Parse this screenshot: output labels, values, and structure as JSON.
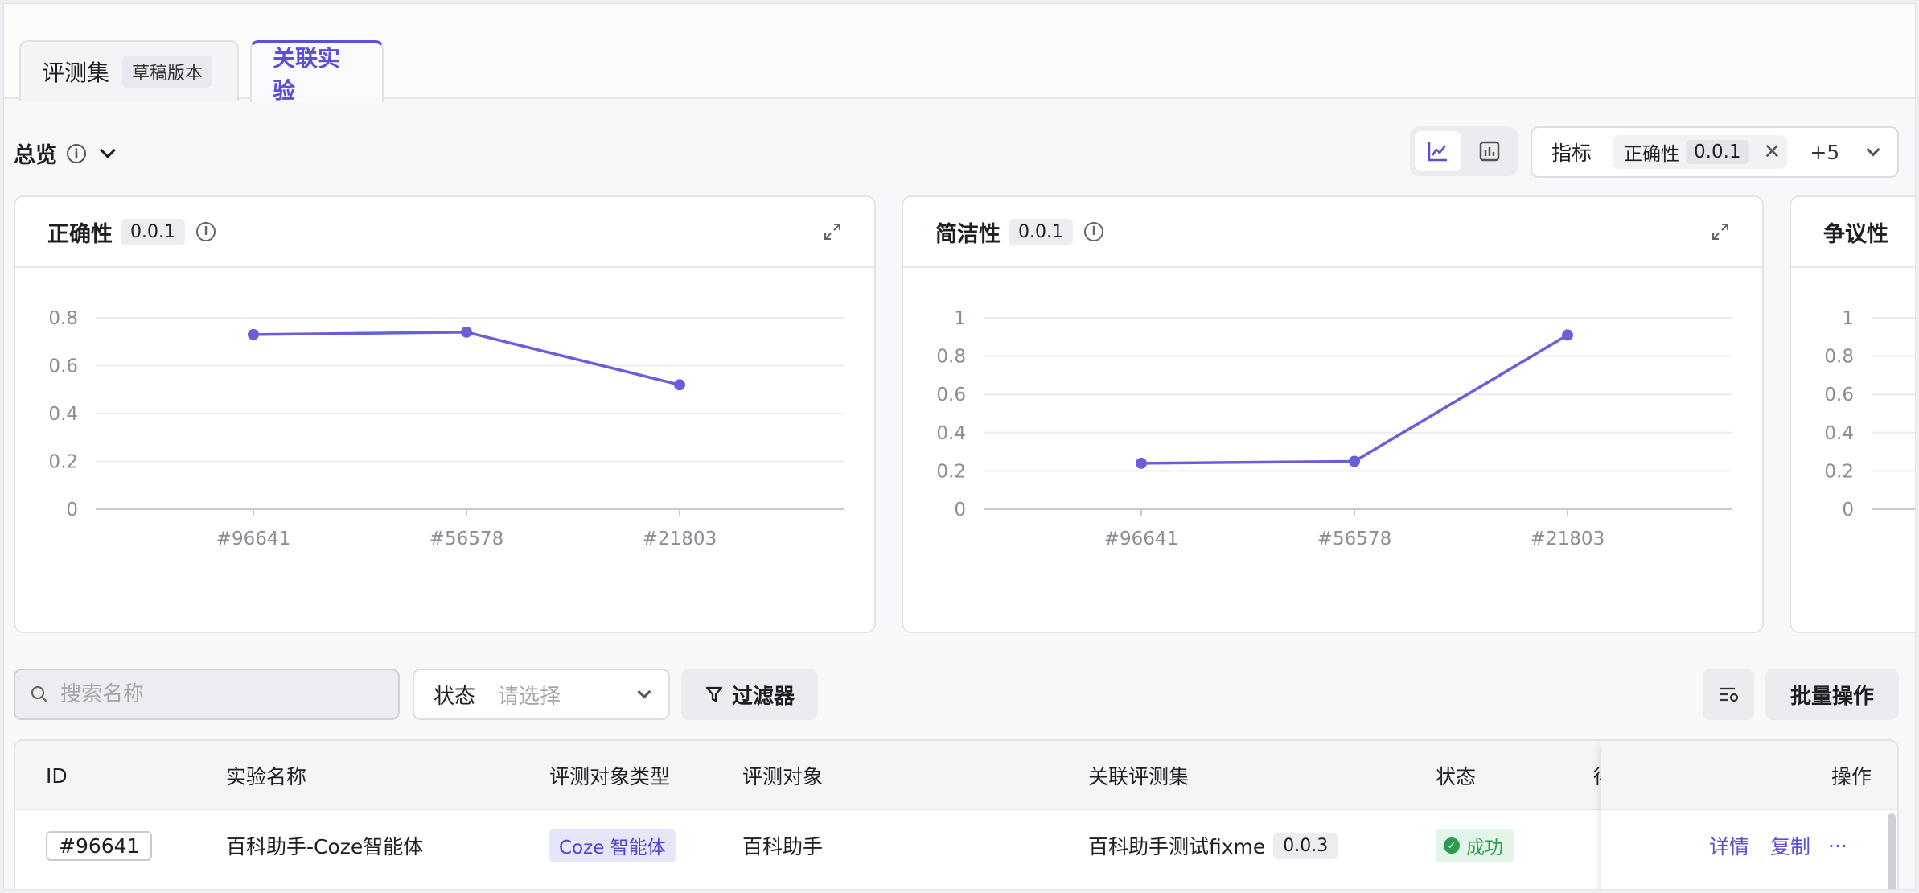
{
  "tabs": [
    {
      "label": "评测集",
      "badge": "草稿版本"
    },
    {
      "label": "关联实验"
    }
  ],
  "overview": {
    "title": "总览"
  },
  "view_toggle": {
    "options": [
      "line-chart-icon",
      "bar-chart-icon"
    ],
    "active": "line-chart-icon"
  },
  "metric_select": {
    "label": "指标",
    "selected_tag": "正确性",
    "selected_version": "0.0.1",
    "more": "+5"
  },
  "charts": [
    {
      "title": "正确性",
      "version": "0.0.1"
    },
    {
      "title": "简洁性",
      "version": "0.0.1"
    },
    {
      "title": "争议性"
    }
  ],
  "chart_data": [
    {
      "type": "line",
      "title": "正确性",
      "categories": [
        "#96641",
        "#56578",
        "#21803"
      ],
      "values": [
        0.73,
        0.74,
        0.52
      ],
      "ylim": [
        0,
        0.8
      ],
      "yticks": [
        "0",
        "0.2",
        "0.4",
        "0.6",
        "0.8"
      ],
      "grid": true,
      "color": "#6a5fd8"
    },
    {
      "type": "line",
      "title": "简洁性",
      "categories": [
        "#96641",
        "#56578",
        "#21803"
      ],
      "values": [
        0.24,
        0.25,
        0.91
      ],
      "ylim": [
        0,
        1
      ],
      "yticks": [
        "0",
        "0.2",
        "0.4",
        "0.6",
        "0.8",
        "1"
      ],
      "grid": true,
      "color": "#6a5fd8"
    },
    {
      "type": "line",
      "title": "争议性",
      "categories": [],
      "values": [],
      "ylim": [
        0,
        1
      ],
      "yticks": [
        "0",
        "0.2",
        "0.4",
        "0.6",
        "0.8",
        "1"
      ],
      "grid": true,
      "color": "#6a5fd8"
    }
  ],
  "toolbar": {
    "search_placeholder": "搜索名称",
    "status_label": "状态",
    "status_placeholder": "请选择",
    "filter_label": "过滤器",
    "batch_label": "批量操作"
  },
  "table": {
    "columns": [
      "ID",
      "实验名称",
      "评测对象类型",
      "评测对象",
      "关联评测集",
      "状态",
      "得",
      "操作"
    ],
    "rows": [
      {
        "id": "#96641",
        "name": "百科助手-Coze智能体",
        "target_type": "Coze 智能体",
        "target": "百科助手",
        "dataset": "百科助手测试fixme",
        "dataset_version": "0.0.3",
        "status": "成功",
        "actions": [
          "详情",
          "复制",
          "···"
        ]
      }
    ]
  },
  "colors": {
    "accent": "#5a4fd6",
    "success": "#2d9a4f"
  }
}
